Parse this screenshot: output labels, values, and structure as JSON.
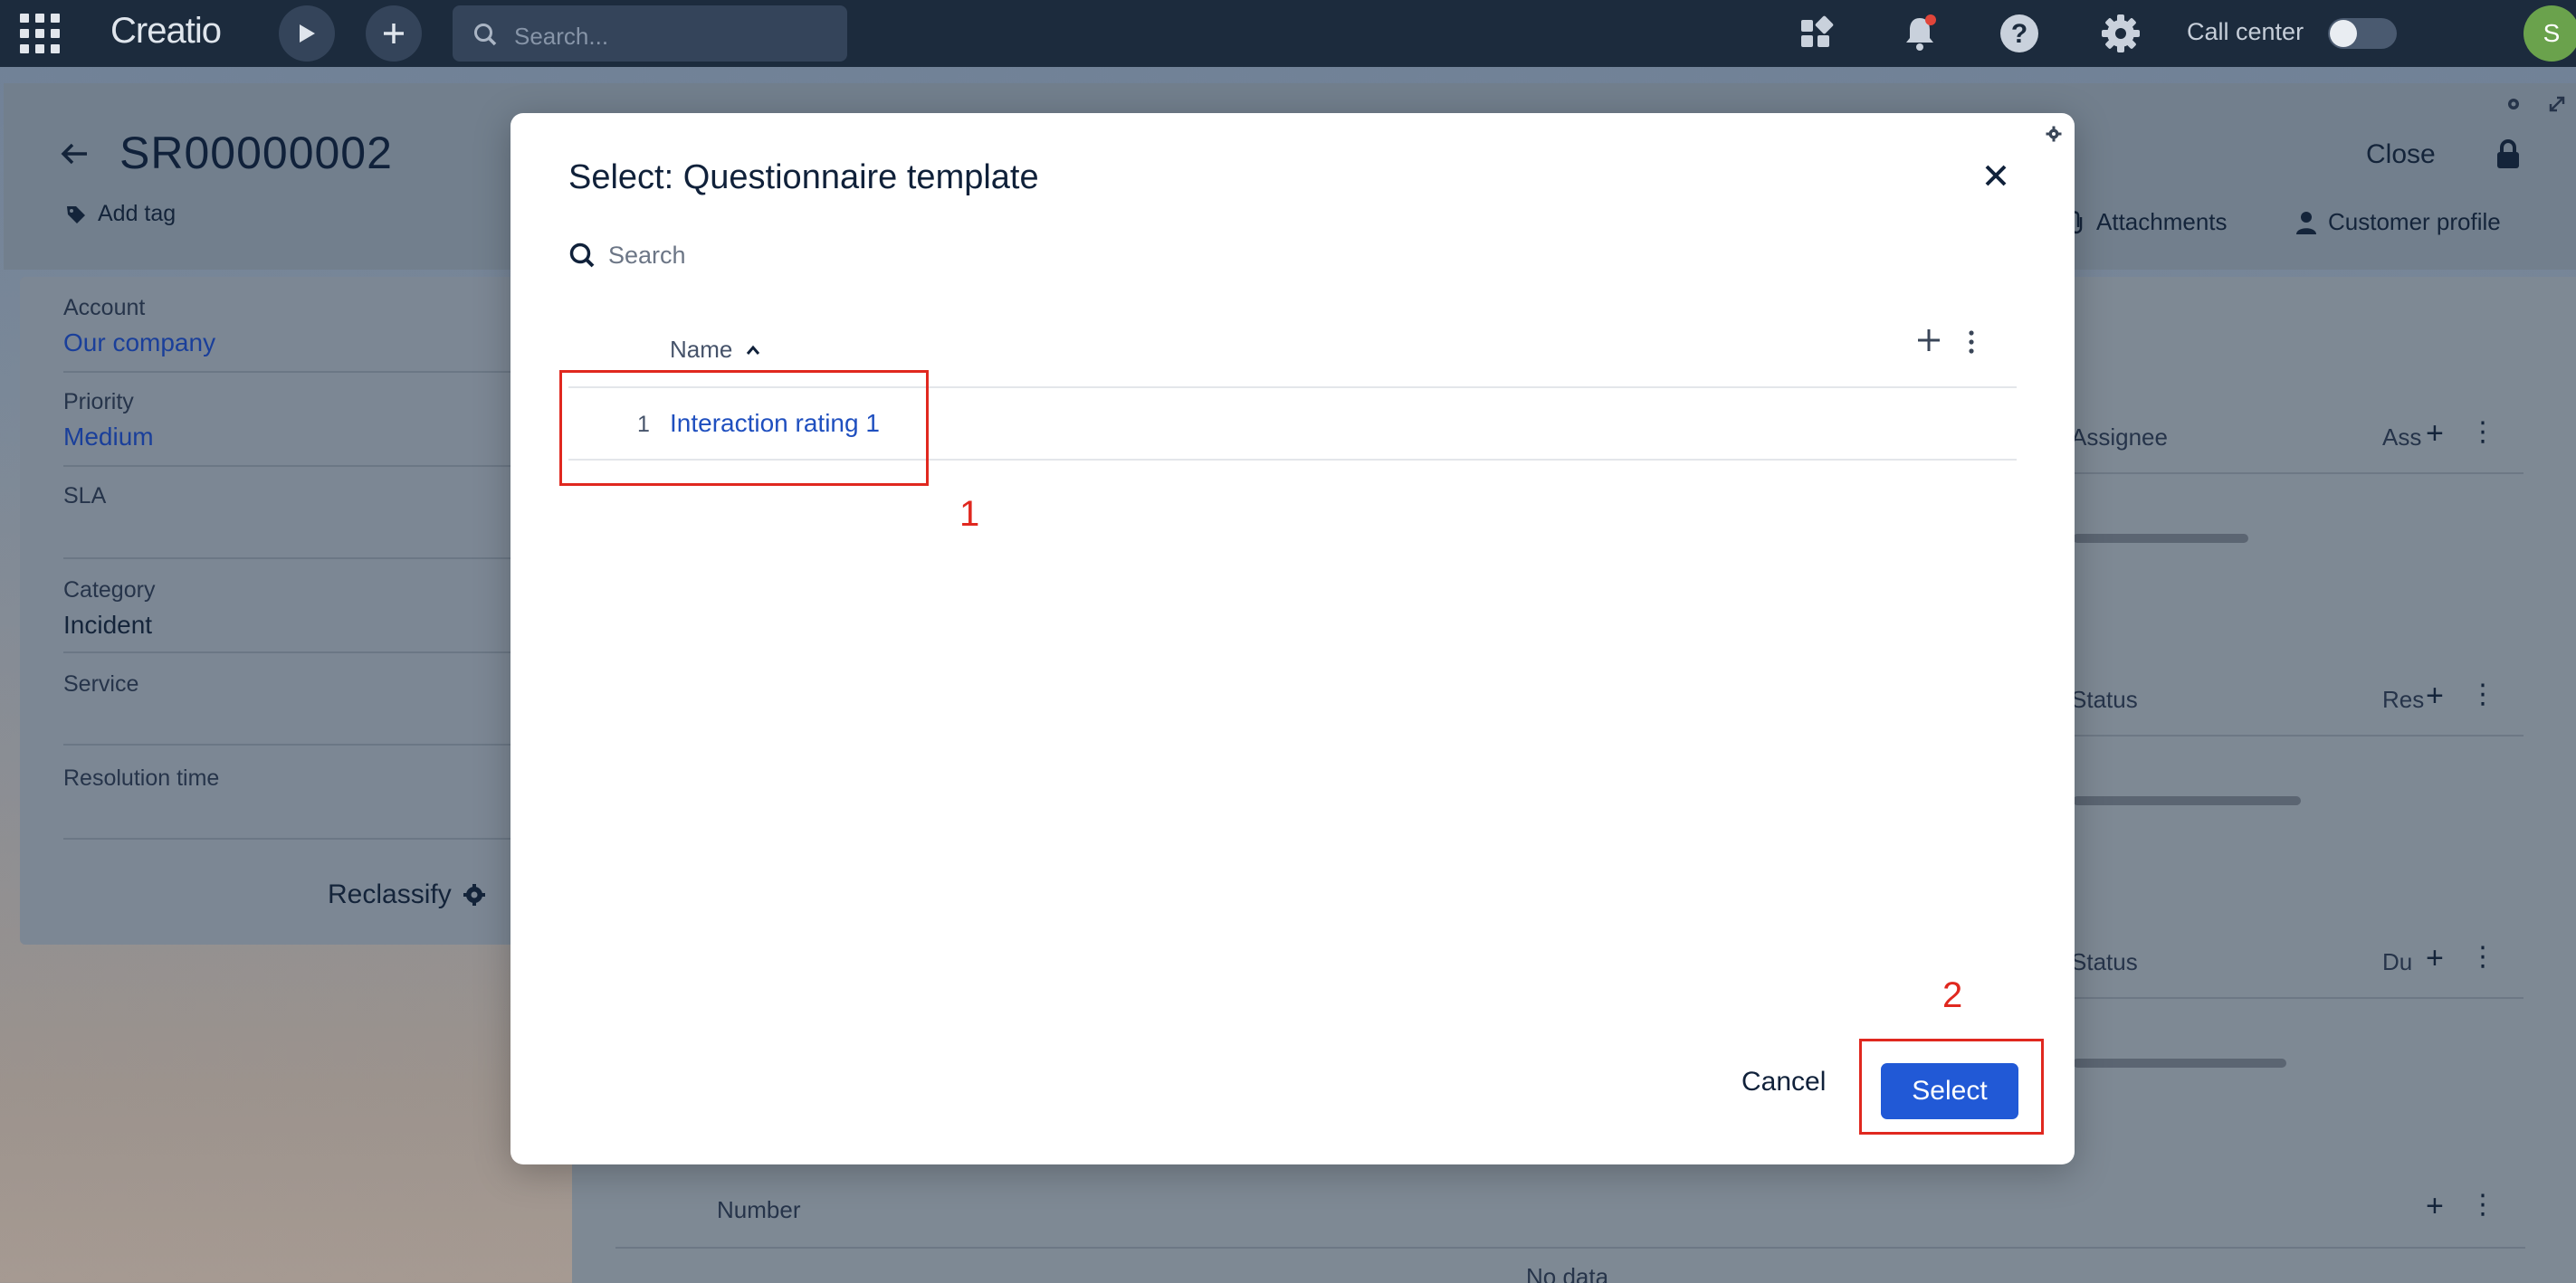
{
  "topbar": {
    "logo": "Creatio",
    "search_placeholder": "Search...",
    "call_center_label": "Call center",
    "avatar_initial": "S",
    "notification_dot_color": "#e0453a"
  },
  "record": {
    "title": "SR00000002",
    "add_tag": "Add tag",
    "close": "Close",
    "attachments": "Attachments",
    "customer_profile": "Customer profile"
  },
  "fields": {
    "account_label": "Account",
    "account_value": "Our company",
    "priority_label": "Priority",
    "priority_value": "Medium",
    "sla_label": "SLA",
    "category_label": "Category",
    "category_value": "Incident",
    "service_label": "Service",
    "resolution_label": "Resolution time",
    "reclassify": "Reclassify"
  },
  "background_grids": {
    "assignee_header": "Assignee",
    "assignee_short": "Ass",
    "status_header_1": "Status",
    "res_short": "Res",
    "status_header_2": "Status",
    "du_short": "Du",
    "number_header": "Number",
    "no_data": "No data"
  },
  "modal": {
    "title": "Select: Questionnaire template",
    "search_placeholder": "Search",
    "column_name": "Name",
    "rows": [
      {
        "num": "1",
        "name": "Interaction rating 1"
      }
    ],
    "cancel": "Cancel",
    "select": "Select"
  },
  "annotations": {
    "step1": "1",
    "step2": "2",
    "color": "#e0281f"
  }
}
